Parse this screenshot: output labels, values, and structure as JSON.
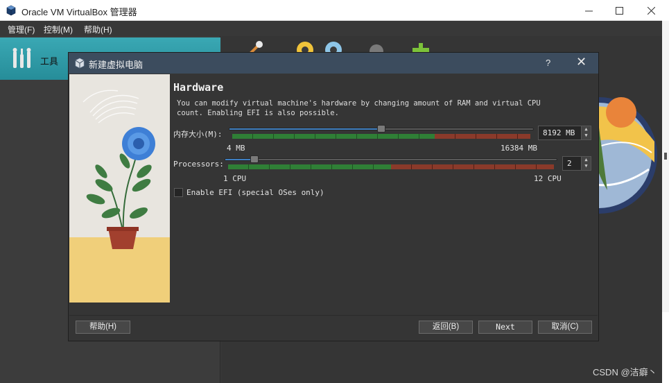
{
  "window": {
    "title": "Oracle VM VirtualBox 管理器",
    "min_icon": "minimize-icon",
    "max_icon": "maximize-icon",
    "close_icon": "close-icon"
  },
  "menubar": {
    "items": [
      "管理(F)",
      "控制(M)",
      "帮助(H)"
    ]
  },
  "sidebar": {
    "tools_label": "工具"
  },
  "dialog": {
    "title": "新建虚拟电脑",
    "help_glyph": "?",
    "close_glyph": "✕",
    "heading": "Hardware",
    "description": "You can modify virtual machine's hardware by changing amount of RAM and virtual CPU count. Enabling EFI is also possible.",
    "memory": {
      "label": "内存大小(M):",
      "value": "8192 MB",
      "min_label": "4 MB",
      "max_label": "16384 MB",
      "value_fraction": 0.5,
      "green_fraction": 0.68,
      "yellow_fraction": 0.0
    },
    "processors": {
      "label": "Processors:",
      "value": "2",
      "min_label": "1 CPU",
      "max_label": "12 CPU",
      "value_fraction": 0.09,
      "green_fraction": 0.5
    },
    "efi": {
      "label": "Enable EFI (special OSes only)",
      "checked": false
    },
    "buttons": {
      "help": "帮助(H)",
      "back": "返回(B)",
      "next": "Next",
      "cancel": "取消(C)"
    }
  },
  "watermark": "CSDN @洁癖丶",
  "colors": {
    "title_bar_dialog": "#3c4c5e",
    "tools_accent": "#2f9aa6",
    "slider_green": "#2f7f36",
    "slider_red": "#8a3a2a"
  }
}
